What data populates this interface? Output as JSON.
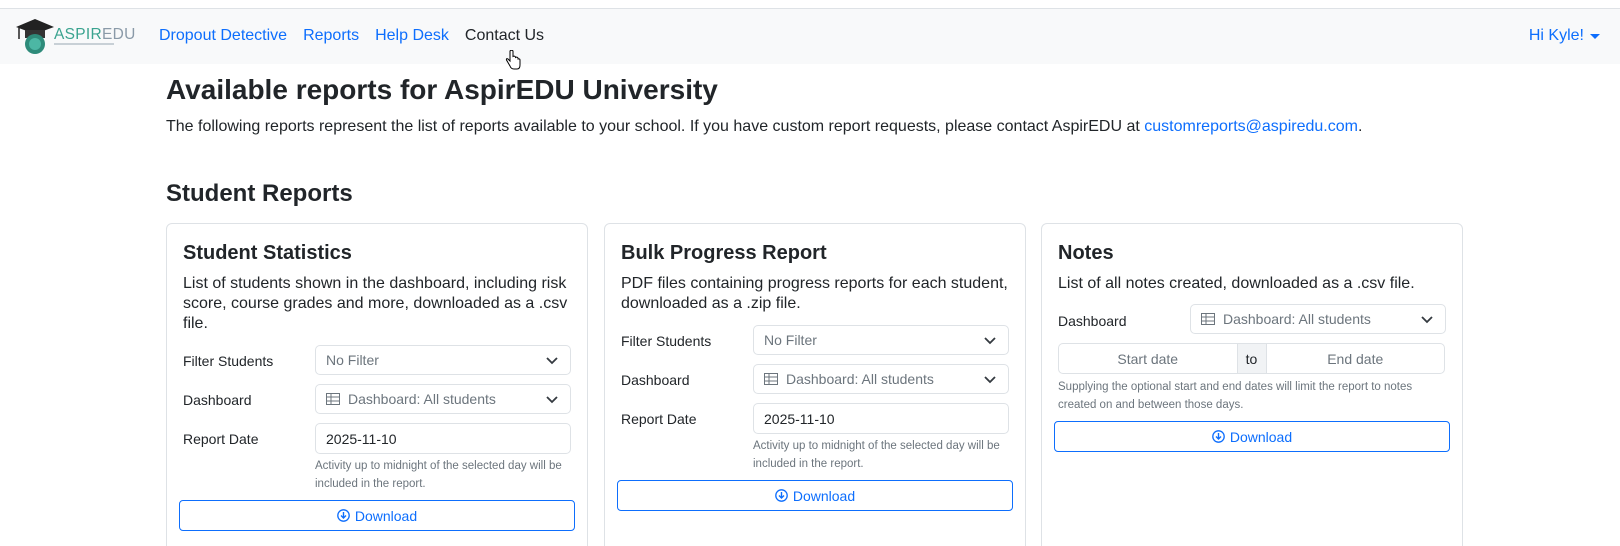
{
  "brand": {
    "name_part1": "ASPIR",
    "name_part2": "EDU"
  },
  "nav": {
    "links": [
      {
        "label": "Dropout Detective"
      },
      {
        "label": "Reports"
      },
      {
        "label": "Help Desk"
      },
      {
        "label": "Contact Us"
      }
    ],
    "user": "Hi Kyle!"
  },
  "page": {
    "title": "Available reports for AspirEDU University",
    "intro": "The following reports represent the list of reports available to your school. If you have custom report requests, please contact AspirEDU at",
    "email": "customreports@aspiredu.com",
    "intro_end": ".",
    "section_title": "Student Reports"
  },
  "cards": [
    {
      "title": "Student Statistics",
      "description": "List of students shown in the dashboard, including risk score, course grades and more, downloaded as a .csv file.",
      "filter_label": "Filter Students",
      "filter_value": "No Filter",
      "dashboard_label": "Dashboard",
      "dashboard_value": "Dashboard: All students",
      "date_label": "Report Date",
      "date_value": "2025-11-10",
      "help": "Activity up to midnight of the selected day will be included in the report.",
      "button": "Download"
    },
    {
      "title": "Bulk Progress Report",
      "description": "PDF files containing progress reports for each student, downloaded as a .zip file.",
      "filter_label": "Filter Students",
      "filter_value": "No Filter",
      "dashboard_label": "Dashboard",
      "dashboard_value": "Dashboard: All students",
      "date_label": "Report Date",
      "date_value": "2025-11-10",
      "help": "Activity up to midnight of the selected day will be included in the report.",
      "button": "Download"
    },
    {
      "title": "Notes",
      "description": "List of all notes created, downloaded as a .csv file.",
      "dashboard_label": "Dashboard",
      "dashboard_value": "Dashboard: All students",
      "start_placeholder": "Start date",
      "to_label": "to",
      "end_placeholder": "End date",
      "help": "Supplying the optional start and end dates will limit the report to notes created on and between those days.",
      "button": "Download"
    }
  ],
  "colors": {
    "link": "#0d6efd",
    "border": "#dee2e6",
    "navbar_bg": "#f8f9fa",
    "brand_teal": "#3aa38f"
  }
}
